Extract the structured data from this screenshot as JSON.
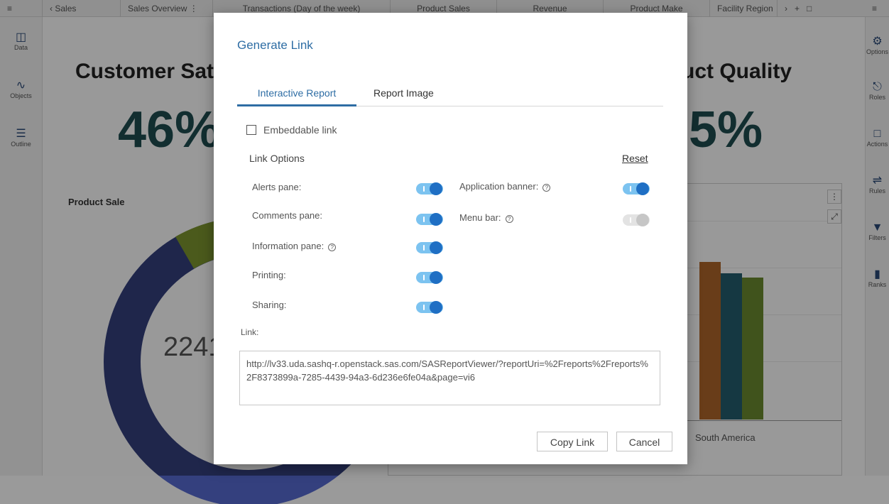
{
  "report_tabs": [
    "Sales",
    "Sales Overview",
    "Transactions (Day of the week)",
    "Product Sales",
    "Revenue",
    "Product Make",
    "Facility Region"
  ],
  "left_rail": [
    "Data",
    "Objects",
    "Outline"
  ],
  "right_rail": [
    "Options",
    "Roles",
    "Actions",
    "Rules",
    "Filters",
    "Ranks"
  ],
  "report": {
    "kpi_left_title": "Customer Sat",
    "kpi_left_value": "46%",
    "kpi_right_title": "uct Quality",
    "kpi_right_value": "5%",
    "donut_title": "Product Sale",
    "donut_center": "2241",
    "bar_x_label": "South America"
  },
  "modal": {
    "title": "Generate Link",
    "tabs": [
      "Interactive Report",
      "Report Image"
    ],
    "embeddable_label": "Embeddable link",
    "link_options_label": "Link Options",
    "reset_label": "Reset",
    "options_left": [
      {
        "label": "Alerts pane:",
        "help": false,
        "on": true
      },
      {
        "label": "Comments pane:",
        "help": false,
        "on": true
      },
      {
        "label": "Information pane:",
        "help": true,
        "on": true
      },
      {
        "label": "Printing:",
        "help": false,
        "on": true
      },
      {
        "label": "Sharing:",
        "help": false,
        "on": true
      }
    ],
    "options_right": [
      {
        "label": "Application banner:",
        "help": true,
        "on": true,
        "disabled": false
      },
      {
        "label": "Menu bar:",
        "help": true,
        "on": true,
        "disabled": true
      }
    ],
    "link_label": "Link:",
    "link_value": "http://lv33.uda.sashq-r.openstack.sas.com/SASReportViewer/?reportUri=%2Freports%2Freports%2F8373899a-7285-4439-94a3-6d236e6fe04a&page=vi6",
    "copy_button": "Copy Link",
    "cancel_button": "Cancel"
  },
  "colors": {
    "accent": "#2e6da4",
    "toggle_track": "#7cc3f0",
    "toggle_knob": "#1f6fc4",
    "kpi": "#1f4e50"
  }
}
